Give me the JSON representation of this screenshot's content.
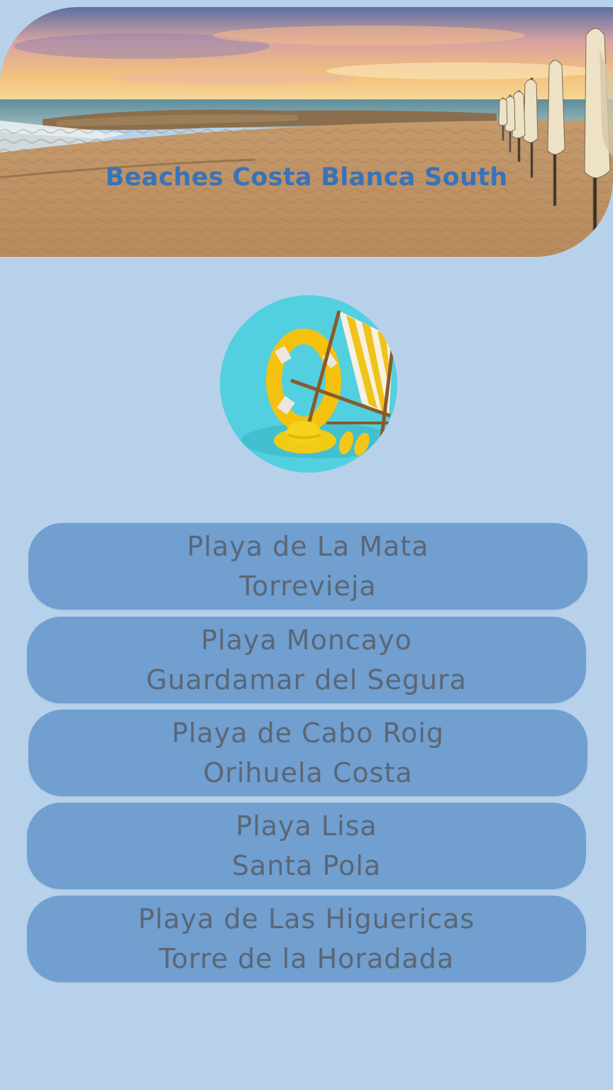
{
  "header": {
    "title": "Beaches Costa Blanca South"
  },
  "images": {
    "header_photo": "beach-sunset-umbrellas",
    "logo": "beach-chair-lifebuoy-hat-icon"
  },
  "colors": {
    "background": "#b7d1eb",
    "button": "#709fd0",
    "button_text": "#5b6676",
    "title": "#3a72b8"
  },
  "beaches": [
    {
      "name": "Playa de La Mata",
      "town": "Torrevieja"
    },
    {
      "name": "Playa Moncayo",
      "town": "Guardamar del Segura"
    },
    {
      "name": "Playa de Cabo Roig",
      "town": "Orihuela Costa"
    },
    {
      "name": "Playa Lisa",
      "town": "Santa Pola"
    },
    {
      "name": "Playa de Las Higuericas",
      "town": "Torre de la Horadada"
    }
  ]
}
